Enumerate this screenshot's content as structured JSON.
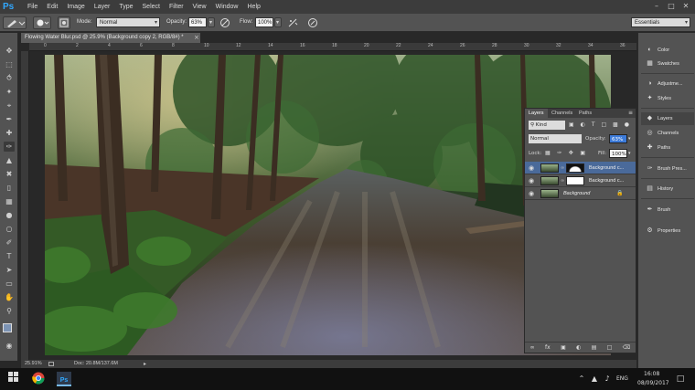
{
  "app": {
    "logo": "Ps"
  },
  "menu": [
    "File",
    "Edit",
    "Image",
    "Layer",
    "Type",
    "Select",
    "Filter",
    "View",
    "Window",
    "Help"
  ],
  "options_bar": {
    "mode_label": "Mode:",
    "mode_value": "Normal",
    "opacity_label": "Opacity:",
    "opacity_value": "63%",
    "flow_label": "Flow:",
    "flow_value": "100%",
    "workspace": "Essentials"
  },
  "document": {
    "tab_title": "Flowing Water Blur.psd @ 25.9% (Background copy 2, RGB/8#) *",
    "ruler_marks": [
      "0",
      "2",
      "4",
      "6",
      "8",
      "10",
      "12",
      "14",
      "16",
      "18",
      "20",
      "22",
      "24",
      "26",
      "28",
      "30",
      "32",
      "34",
      "36"
    ]
  },
  "status_bar": {
    "zoom": "25.91%",
    "doc_info": "Doc: 20.8M/137.6M"
  },
  "layers_panel": {
    "tabs": [
      "Layers",
      "Channels",
      "Paths"
    ],
    "filter_kind": "Kind",
    "blend_mode": "Normal",
    "opacity_label": "Opacity:",
    "opacity_value": "63%",
    "lock_label": "Lock:",
    "fill_label": "Fill:",
    "fill_value": "100%",
    "layers": [
      {
        "name": "Background c...",
        "selected": true,
        "has_mask": true
      },
      {
        "name": "Background c...",
        "selected": false,
        "has_mask": true
      },
      {
        "name": "Background",
        "selected": false,
        "has_mask": false
      }
    ]
  },
  "dock": {
    "items": [
      "Color",
      "Swatches",
      "Adjustme...",
      "Styles",
      "Layers",
      "Channels",
      "Paths",
      "Brush Pres...",
      "History",
      "Brush",
      "Properties"
    ]
  },
  "taskbar": {
    "language": "ENG",
    "time": "16:08",
    "date": "08/09/2017"
  },
  "colors": {
    "accent": "#31a8ff",
    "panel_bg": "#535353",
    "selected_layer": "#4a6a9a"
  }
}
